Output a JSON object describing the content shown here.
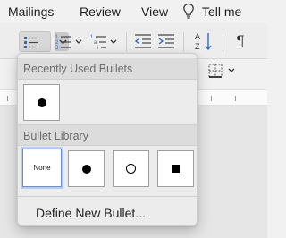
{
  "ribbon": {
    "tabs": [
      "Mailings",
      "Review",
      "View"
    ],
    "tell_me": "Tell me",
    "pilcrow": "¶"
  },
  "bullets_menu": {
    "recent_header": "Recently Used Bullets",
    "library_header": "Bullet Library",
    "recent_items": [
      "disc"
    ],
    "library_items": [
      {
        "label": "None",
        "glyph": "none",
        "selected": true
      },
      {
        "glyph": "disc"
      },
      {
        "glyph": "circle"
      },
      {
        "glyph": "square"
      }
    ],
    "define_new": "Define New Bullet..."
  },
  "colors": {
    "selection_border": "#6d8fc6",
    "popup_bg": "#ececec",
    "header_bg": "#dcdcdc"
  },
  "icons": [
    "bulb-icon",
    "bullets-icon",
    "numbering-icon",
    "multilevel-list-icon",
    "decrease-indent-icon",
    "increase-indent-icon",
    "sort-icon",
    "pilcrow-icon",
    "borders-icon"
  ]
}
